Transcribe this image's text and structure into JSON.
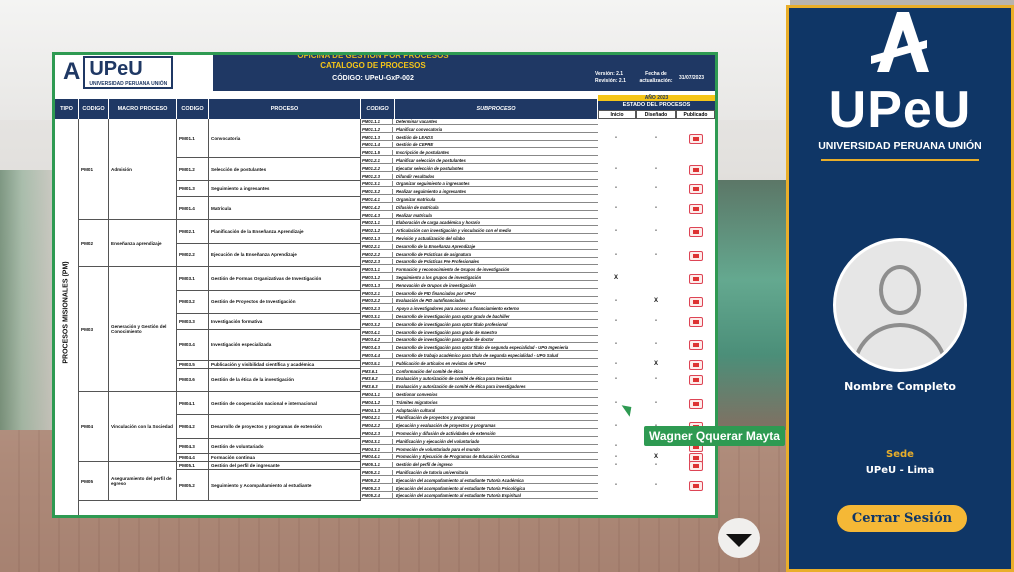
{
  "header": {
    "band_title": "OFICINA DE GESTIÓN POR PROCESOS",
    "doc_title": "CATALOGO DE PROCESOS",
    "code": "CÓDIGO: UPeU-GxP-002",
    "version": "Versión: 2.1",
    "revision": "Revisión: 2.1",
    "fecha_label": "Fecha de actualización:",
    "fecha_value": "31/07/2023",
    "logo_text": "UPeU",
    "logo_sub": "UNIVERSIDAD PERUANA UNIÓN"
  },
  "table": {
    "columns": [
      "TIPO",
      "CODIGO",
      "MACRO PROCESO",
      "CODIGO",
      "PROCESO",
      "CODIGO",
      "SUBPROCESO"
    ],
    "year": "AÑO 2023",
    "estado": "ESTADO DEL PROCESOS",
    "status_cols": [
      "Inicio",
      "Diseñado",
      "Publicado"
    ],
    "tipo": "PROCESOS MISIONALES (PM)",
    "macros": [
      {
        "code": "PM01",
        "name": "Admisión"
      },
      {
        "code": "PM02",
        "name": "Enseñanza aprendizaje"
      },
      {
        "code": "PM03",
        "name": "Generación y Gestión del Conocimiento"
      },
      {
        "code": "PM04",
        "name": "Vinculación con la Sociedad"
      },
      {
        "code": "PM05",
        "name": "Aseguramiento del perfil de egreso"
      }
    ],
    "procesos": [
      {
        "code": "PM01.1",
        "name": "Convocatoria",
        "inicio": "-",
        "disenado": "-"
      },
      {
        "code": "PM01.2",
        "name": "Selección de postulantes",
        "inicio": "-",
        "disenado": "-"
      },
      {
        "code": "PM01.3",
        "name": "Seguimiento a ingresantes",
        "inicio": "-",
        "disenado": "-"
      },
      {
        "code": "PM01.4",
        "name": "Matrícula",
        "inicio": "-",
        "disenado": "-"
      },
      {
        "code": "PM02.1",
        "name": "Planificación de la Enseñanza Aprendizaje",
        "inicio": "-",
        "disenado": "-"
      },
      {
        "code": "PM02.2",
        "name": "Ejecución de la Enseñanza Aprendizaje",
        "inicio": "-",
        "disenado": "-"
      },
      {
        "code": "PM03.1",
        "name": "Gestión de Formas Organizativas de Investigación",
        "inicio": "X",
        "disenado": ""
      },
      {
        "code": "PM03.2",
        "name": "Gestión de Proyectos de Investigación",
        "inicio": "-",
        "disenado": "X"
      },
      {
        "code": "PM03.3",
        "name": "Investigación formativa",
        "inicio": "-",
        "disenado": "-"
      },
      {
        "code": "PM03.4",
        "name": "Investigación especializada",
        "inicio": "-",
        "disenado": "-"
      },
      {
        "code": "PM03.5",
        "name": "Publicación y visibilidad científica y académica",
        "inicio": "-",
        "disenado": "X"
      },
      {
        "code": "PM03.6",
        "name": "Gestión de la ética de la investigación",
        "inicio": "-",
        "disenado": "-"
      },
      {
        "code": "PM04.1",
        "name": "Gestión de cooperación nacional e internacional",
        "inicio": "-",
        "disenado": "-"
      },
      {
        "code": "PM04.2",
        "name": "Desarrollo de proyectos y programas de extensión",
        "inicio": "-",
        "disenado": "-"
      },
      {
        "code": "PM04.3",
        "name": "Gestión de voluntariado",
        "inicio": "-",
        "disenado": "-"
      },
      {
        "code": "PM04.4",
        "name": "Formación continua",
        "inicio": "-",
        "disenado": "X"
      },
      {
        "code": "PM05.1",
        "name": "Gestión del perfil de ingresante",
        "inicio": "-",
        "disenado": "-"
      },
      {
        "code": "PM05.2",
        "name": "Seguimiento y Acompañamiento al estudiante",
        "inicio": "-",
        "disenado": "-"
      }
    ],
    "subprocesos": [
      [
        "PM01.1.1",
        "Determinar vacantes"
      ],
      [
        "PM01.1.2",
        "Planificar convocatoria"
      ],
      [
        "PM01.1.3",
        "Gestión de LEADS"
      ],
      [
        "PM01.1.4",
        "Gestión de CEPRE"
      ],
      [
        "PM01.1.5",
        "Inscripción de postulantes"
      ],
      [
        "PM01.2.1",
        "Planificar selección de postulantes"
      ],
      [
        "PM01.2.2",
        "Ejecutar selección de postulantes"
      ],
      [
        "PM01.2.3",
        "Difundir resultados"
      ],
      [
        "PM01.3.1",
        "Organizar seguimiento a ingresantes"
      ],
      [
        "PM01.3.2",
        "Realizar seguimiento a ingresantes"
      ],
      [
        "PM01.4.1",
        "Organizar matrícula"
      ],
      [
        "PM01.4.2",
        "Difusión de matrícula"
      ],
      [
        "PM01.4.3",
        "Realizar matrícula"
      ],
      [
        "PM02.1.1",
        "Elaboración de carga académica y horario"
      ],
      [
        "PM02.1.2",
        "Articulación con investigación y vinculación con el medio"
      ],
      [
        "PM02.1.3",
        "Revisión y actualización del sílabo"
      ],
      [
        "PM02.2.1",
        "Desarrollo de la Enseñanza Aprendizaje"
      ],
      [
        "PM02.2.2",
        "Desarrollo de Prácticas de asignatura"
      ],
      [
        "PM02.2.3",
        "Desarrollo de Prácticas Pre Profesionales"
      ],
      [
        "PM03.1.1",
        "Formación y reconocimiento de Grupos de investigación"
      ],
      [
        "PM03.1.2",
        "Seguimiento a los grupos de investigación"
      ],
      [
        "PM03.1.3",
        "Renovación de Grupos de investigación"
      ],
      [
        "PM03.2.1",
        "Desarrollo de PID financiados por UPeU"
      ],
      [
        "PM03.2.2",
        "Evaluación de PID autofinanciados"
      ],
      [
        "PM03.2.3",
        "Apoyo a investigadores para acceso a financiamiento externo"
      ],
      [
        "PM03.3.1",
        "Desarrollo de investigación para optar grado de bachiller"
      ],
      [
        "PM03.3.2",
        "Desarrollo de investigación para optar título profesional"
      ],
      [
        "PM03.4.1",
        "Desarrollo de investigación para grado de maestro"
      ],
      [
        "PM03.4.2",
        "Desarrollo de investigación para grado de doctor"
      ],
      [
        "PM03.4.3",
        "Desarrollo de investigación para optar título de segunda especialidad - UPG Ingeniería"
      ],
      [
        "PM03.4.4",
        "Desarrollo de trabajo académico para título de segunda especialidad - UPG Salud"
      ],
      [
        "PM03.5.1",
        "Publicación de artículos en revistas de UPeU"
      ],
      [
        "PM3.6.1",
        "Conformación del comité de ética"
      ],
      [
        "PM3.6.2",
        "Evaluación y autorización de comité de ética para tesistas"
      ],
      [
        "PM3.6.3",
        "Evaluación y autorización de comité de ética para investigadores"
      ],
      [
        "PM04.1.1",
        "Gestionar convenios"
      ],
      [
        "PM04.1.2",
        "Trámites migratorios"
      ],
      [
        "PM04.1.3",
        "Adaptación cultural"
      ],
      [
        "PM04.2.1",
        "Planificación de proyectos y programas"
      ],
      [
        "PM04.2.2",
        "Ejecución y evaluación de proyectos y programas"
      ],
      [
        "PM04.2.3",
        "Promoción y difusión de actividades de extensión"
      ],
      [
        "PM04.3.1",
        "Planificación y ejecución del voluntariado"
      ],
      [
        "PM04.3.1",
        "Promoción de voluntariado para el mundo"
      ],
      [
        "PM04.4.1",
        "Promoción y Ejecución de Programas de Educación Continua"
      ],
      [
        "PM05.1.1",
        "Gestión del perfil de ingreso"
      ],
      [
        "PM05.2.1",
        "Planificación de tutoría universitaria"
      ],
      [
        "PM05.2.2",
        "Ejecución del acompañamiento al estudiante Tutoría Académica"
      ],
      [
        "PM05.2.3",
        "Ejecución del acompañamiento al estudiante Tutoría Psicológica"
      ],
      [
        "PM05.2.4",
        "Ejecución del acompañamiento al estudiante Tutoría Espiritual"
      ]
    ]
  },
  "cursor_label": "Wagner Qquerar Mayta",
  "panel": {
    "logo": "UPeU",
    "university": "UNIVERSIDAD PERUANA UNIÓN",
    "user_name": "Nombre Completo",
    "sede_label": "Sede",
    "sede_value": "UPeU - Lima",
    "logout_label": "Cerrar Sesión"
  },
  "colors": {
    "navy": "#0f3666",
    "gold": "#e9ae2a",
    "green": "#2e9a52"
  }
}
